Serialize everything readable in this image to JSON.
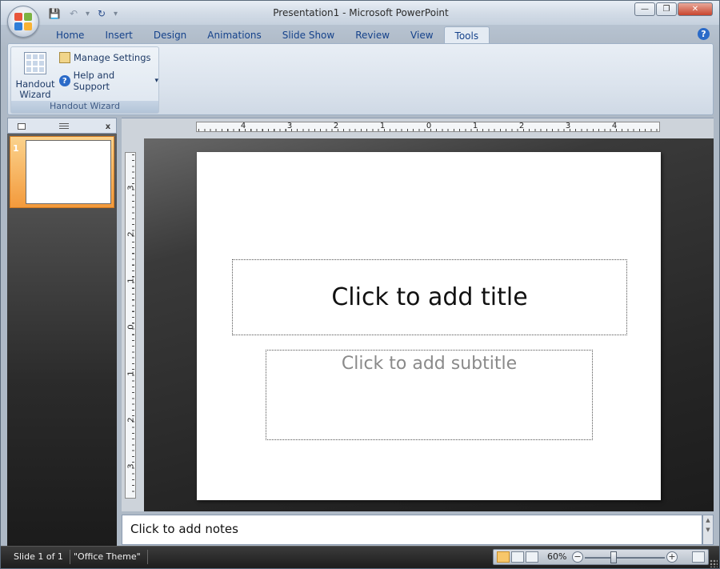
{
  "window": {
    "title": "Presentation1 - Microsoft PowerPoint",
    "controls": {
      "minimize": "—",
      "maximize": "❐",
      "close": "✕"
    }
  },
  "quick_access": {
    "save_icon": "💾",
    "undo_icon": "↶",
    "redo_icon": "↻",
    "customize_icon": "▾"
  },
  "ribbon": {
    "tabs": [
      {
        "label": "Home"
      },
      {
        "label": "Insert"
      },
      {
        "label": "Design"
      },
      {
        "label": "Animations"
      },
      {
        "label": "Slide Show"
      },
      {
        "label": "Review"
      },
      {
        "label": "View"
      },
      {
        "label": "Tools",
        "active": true
      }
    ],
    "help_icon": "?",
    "group": {
      "label": "Handout Wizard",
      "big_button_label_1": "Handout",
      "big_button_label_2": "Wizard",
      "manage_settings": "Manage Settings",
      "help_support": "Help and Support",
      "help_support_arrow": "▾"
    }
  },
  "slides_pane": {
    "close_icon": "x",
    "slides": [
      {
        "number": "1"
      }
    ]
  },
  "hruler": {
    "labels": [
      "4",
      "3",
      "2",
      "1",
      "0",
      "1",
      "2",
      "3",
      "4"
    ]
  },
  "vruler": {
    "labels": [
      "3",
      "2",
      "1",
      "0",
      "1",
      "2",
      "3"
    ]
  },
  "slide": {
    "title_placeholder": "Click to add title",
    "subtitle_placeholder": "Click to add subtitle"
  },
  "notes": {
    "placeholder": "Click to add notes"
  },
  "status": {
    "slide_info": "Slide 1 of 1",
    "theme": "\"Office Theme\"",
    "zoom": "60%",
    "zoom_fraction": 0.6,
    "zoom_minus": "−",
    "zoom_plus": "+"
  },
  "colors": {
    "accent_orange": "#f39a3c",
    "ribbon_text": "#15428b"
  }
}
